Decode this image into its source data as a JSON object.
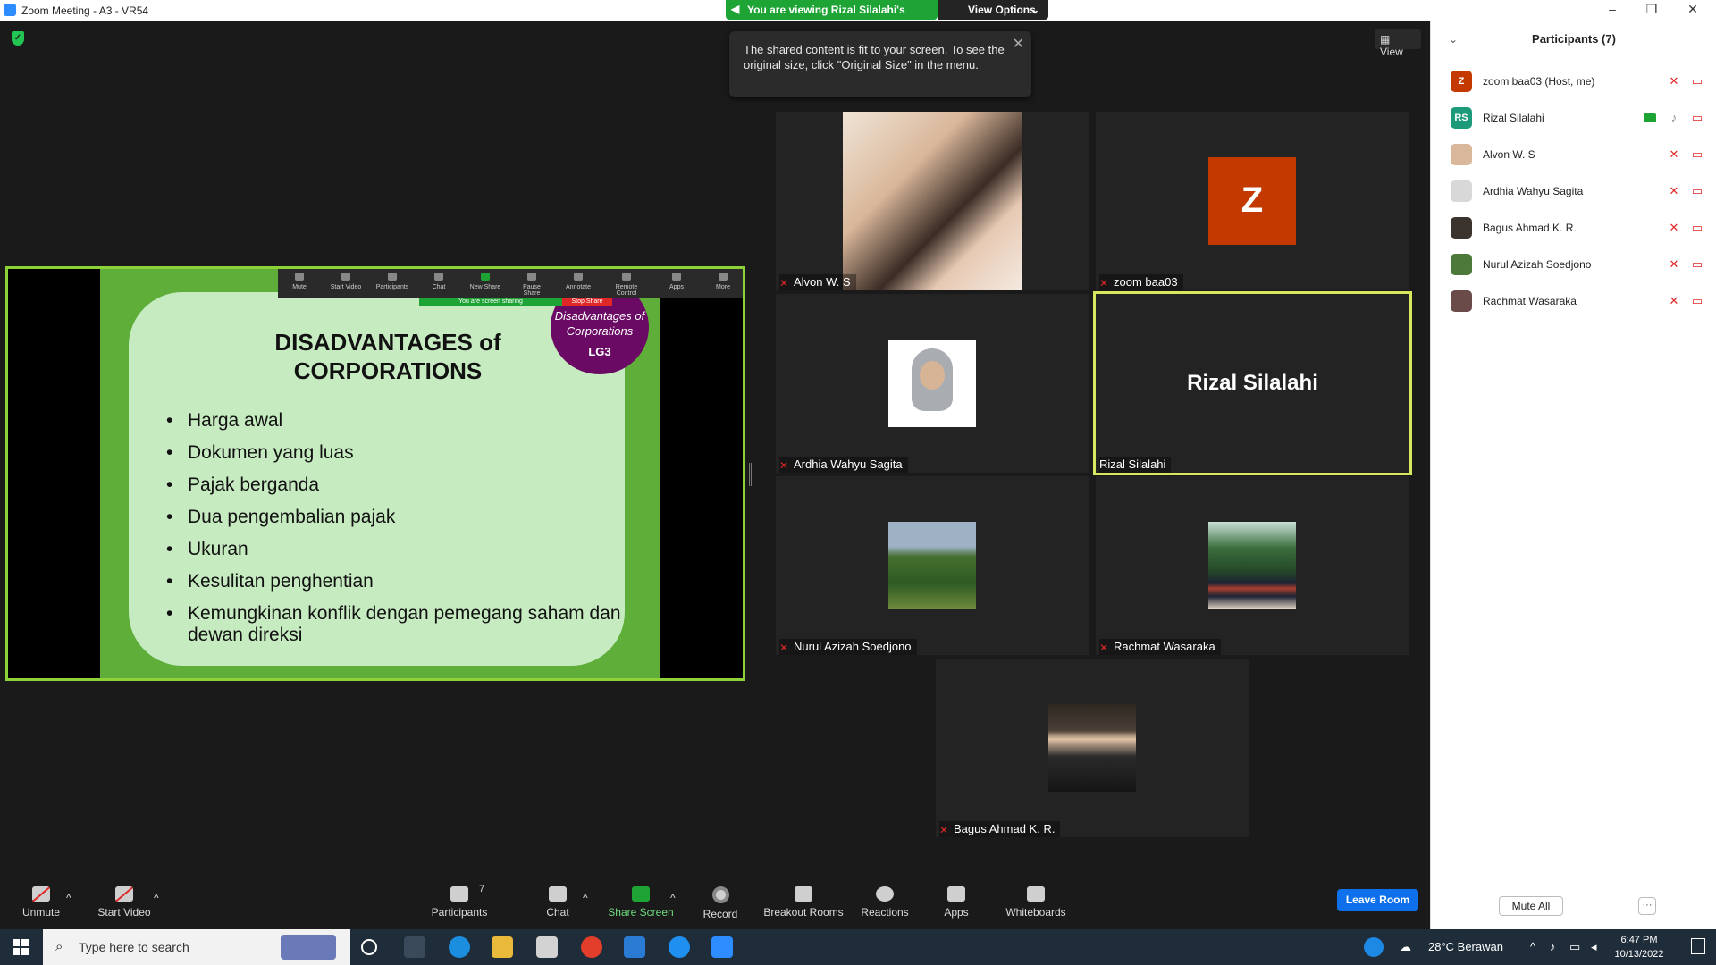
{
  "window": {
    "title": "Zoom Meeting - A3 - VR54",
    "viewing_banner": "You are viewing Rizal Silalahi's screen",
    "view_options": "View Options",
    "view_button": "View",
    "minimize": "–",
    "restore": "❐",
    "close": "✕"
  },
  "tooltip": {
    "text": "The shared content is fit to your screen. To see the original size, click \"Original Size\" in the menu."
  },
  "shared_slide": {
    "title": "DISADVANTAGES of CORPORATIONS",
    "badge_text": "Disadvantages of Corporations",
    "badge_code": "LG3",
    "bullets": [
      "Harga awal",
      "Dokumen yang luas",
      "Pajak berganda",
      "Dua pengembalian pajak",
      "Ukuran",
      "Kesulitan penghentian",
      "Kemungkinan konflik dengan pemegang saham dan dewan direksi"
    ],
    "mini_toolbar": [
      "Mute",
      "Start Video",
      "Participants",
      "Chat",
      "New Share",
      "Pause Share",
      "Annotate",
      "Remote Control",
      "Apps",
      "More"
    ],
    "mini_banner": "You are screen sharing",
    "mini_stop": "Stop Share"
  },
  "tiles": [
    {
      "name": "Alvon W. S"
    },
    {
      "name": "zoom baa03",
      "initial": "Z"
    },
    {
      "name": "Ardhia Wahyu Sagita"
    },
    {
      "name": "Rizal Silalahi",
      "display": "Rizal Silalahi"
    },
    {
      "name": "Nurul Azizah Soedjono"
    },
    {
      "name": "Rachmat Wasaraka"
    },
    {
      "name": "Bagus Ahmad K. R."
    }
  ],
  "toolbar": {
    "unmute": "Unmute",
    "start_video": "Start Video",
    "participants": "Participants",
    "participants_count": "7",
    "chat": "Chat",
    "share_screen": "Share Screen",
    "record": "Record",
    "breakout_rooms": "Breakout Rooms",
    "reactions": "Reactions",
    "apps": "Apps",
    "whiteboards": "Whiteboards",
    "leave_room": "Leave Room"
  },
  "participants_panel": {
    "title": "Participants (7)",
    "mute_all": "Mute All",
    "more": "···",
    "list": [
      {
        "name": "zoom baa03 (Host, me)",
        "initials": "Z",
        "color": "#c33900"
      },
      {
        "name": "Rizal Silalahi",
        "initials": "RS",
        "color": "#1c9a7a"
      },
      {
        "name": "Alvon W. S",
        "initials": "",
        "color": "#d9b79a"
      },
      {
        "name": "Ardhia Wahyu Sagita",
        "initials": "",
        "color": "#d8d8d8"
      },
      {
        "name": "Bagus Ahmad K. R.",
        "initials": "",
        "color": "#3b342e"
      },
      {
        "name": "Nurul Azizah Soedjono",
        "initials": "",
        "color": "#4d7a3b"
      },
      {
        "name": "Rachmat Wasaraka",
        "initials": "",
        "color": "#6b4a4a"
      }
    ]
  },
  "taskbar": {
    "search_placeholder": "Type here to search",
    "weather": "28°C  Berawan",
    "time": "6:47 PM",
    "date": "10/13/2022"
  },
  "colors": {
    "accent_green": "#1ea335",
    "active_speaker_border": "#d8e85e",
    "leave_blue": "#0e71eb",
    "muted_red": "#e02828"
  }
}
